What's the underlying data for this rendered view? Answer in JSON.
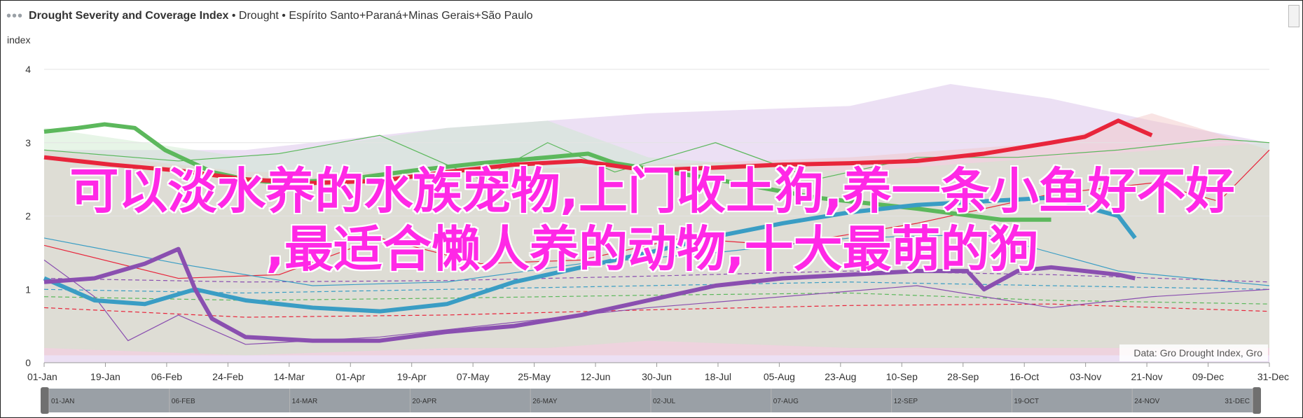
{
  "header": {
    "dots_icon": "ellipsis-icon",
    "title_bold": "Drought Severity and Coverage Index",
    "title_rest": " • Drought • Espírito Santo+Paraná+Minas Gerais+São Paulo"
  },
  "watermark": {
    "line1": "可以淡水养的水族宠物,上门收土狗,养一条小鱼好不好",
    "line2": ",最适合懒人养的动物,十大最萌的狗"
  },
  "chart_data": {
    "type": "line",
    "ylabel": "index",
    "ylim": [
      0,
      4
    ],
    "y_ticks": [
      "0",
      "1",
      "2",
      "3",
      "4"
    ],
    "x_ticks": [
      "01-Jan",
      "19-Jan",
      "06-Feb",
      "24-Feb",
      "14-Mar",
      "01-Apr",
      "19-Apr",
      "07-May",
      "25-May",
      "12-Jun",
      "30-Jun",
      "18-Jul",
      "05-Aug",
      "23-Aug",
      "10-Sep",
      "28-Sep",
      "16-Oct",
      "03-Nov",
      "21-Nov",
      "09-Dec",
      "31-Dec"
    ],
    "navigator_ticks": [
      "01-JAN",
      "06-FEB",
      "14-MAR",
      "20-APR",
      "26-MAY",
      "02-JUL",
      "07-AUG",
      "12-SEP",
      "19-OCT",
      "24-NOV",
      "31-DEC"
    ],
    "source": "Data: Gro Drought Index, Gro",
    "grid": true,
    "x_range_days": [
      0,
      365
    ],
    "series": [
      {
        "color": "#5cb85c",
        "style": "solid-thick",
        "x": [
          0,
          10,
          18,
          27,
          36,
          50,
          60,
          70,
          90,
          110,
          130,
          150,
          162,
          170,
          200,
          230,
          260,
          285,
          300
        ],
        "values": [
          3.15,
          3.2,
          3.25,
          3.2,
          2.9,
          2.6,
          2.5,
          2.45,
          2.5,
          2.62,
          2.72,
          2.8,
          2.85,
          2.72,
          2.5,
          2.25,
          2.1,
          1.95,
          1.95
        ]
      },
      {
        "color": "#e8253b",
        "style": "solid-thick",
        "x": [
          0,
          20,
          40,
          60,
          80,
          100,
          120,
          140,
          160,
          180,
          200,
          220,
          240,
          260,
          280,
          300,
          310,
          320,
          330
        ],
        "values": [
          2.8,
          2.7,
          2.62,
          2.5,
          2.45,
          2.48,
          2.6,
          2.7,
          2.75,
          2.62,
          2.66,
          2.7,
          2.72,
          2.75,
          2.85,
          3.0,
          3.08,
          3.3,
          3.1
        ]
      },
      {
        "color": "#3a9dc4",
        "style": "solid-thick",
        "x": [
          0,
          15,
          30,
          45,
          60,
          80,
          100,
          120,
          140,
          160,
          180,
          200,
          220,
          240,
          260,
          280,
          300,
          320,
          325
        ],
        "values": [
          1.15,
          0.85,
          0.8,
          1.0,
          0.85,
          0.75,
          0.7,
          0.8,
          1.1,
          1.3,
          1.5,
          1.72,
          1.9,
          2.05,
          2.15,
          2.2,
          2.25,
          2.0,
          1.7
        ]
      },
      {
        "color": "#8a4fb0",
        "style": "solid-thick",
        "x": [
          0,
          15,
          30,
          40,
          45,
          50,
          60,
          80,
          100,
          120,
          140,
          160,
          180,
          200,
          220,
          240,
          260,
          275,
          280,
          290,
          300,
          320,
          325
        ],
        "values": [
          1.1,
          1.15,
          1.35,
          1.55,
          1.0,
          0.6,
          0.35,
          0.3,
          0.3,
          0.42,
          0.5,
          0.65,
          0.85,
          1.05,
          1.15,
          1.2,
          1.25,
          1.25,
          1.0,
          1.25,
          1.3,
          1.2,
          1.15
        ]
      },
      {
        "color": "#5cb85c",
        "style": "thin",
        "x": [
          0,
          40,
          70,
          100,
          130,
          150,
          170,
          200,
          230,
          260,
          290,
          320,
          350,
          365
        ],
        "values": [
          2.9,
          2.75,
          2.85,
          3.1,
          2.5,
          3.0,
          2.6,
          3.0,
          2.5,
          2.8,
          2.8,
          2.9,
          3.05,
          3.0
        ]
      },
      {
        "color": "#e8253b",
        "style": "thin",
        "x": [
          0,
          40,
          70,
          100,
          130,
          160,
          190,
          220,
          260,
          300,
          330,
          350,
          365
        ],
        "values": [
          1.6,
          1.15,
          1.2,
          1.7,
          1.35,
          1.4,
          1.7,
          1.6,
          1.9,
          2.3,
          2.45,
          2.2,
          2.9
        ]
      },
      {
        "color": "#3a9dc4",
        "style": "thin",
        "x": [
          0,
          40,
          80,
          120,
          160,
          200,
          240,
          280,
          320,
          365
        ],
        "values": [
          1.7,
          1.35,
          1.05,
          1.1,
          1.35,
          1.5,
          1.7,
          1.75,
          1.25,
          1.05
        ]
      },
      {
        "color": "#8a4fb0",
        "style": "thin",
        "x": [
          0,
          15,
          25,
          40,
          60,
          100,
          140,
          180,
          220,
          260,
          300,
          330,
          365
        ],
        "values": [
          1.4,
          0.9,
          0.3,
          0.65,
          0.25,
          0.35,
          0.55,
          0.75,
          0.9,
          1.05,
          0.75,
          0.9,
          1.0
        ]
      },
      {
        "color": "#e8253b",
        "style": "dashed",
        "x": [
          0,
          60,
          120,
          180,
          240,
          300,
          365
        ],
        "values": [
          0.75,
          0.62,
          0.65,
          0.72,
          0.78,
          0.8,
          0.7
        ]
      },
      {
        "color": "#5cb85c",
        "style": "dashed",
        "x": [
          0,
          60,
          120,
          180,
          240,
          300,
          365
        ],
        "values": [
          0.9,
          0.85,
          0.88,
          0.92,
          0.95,
          0.85,
          0.8
        ]
      },
      {
        "color": "#3a9dc4",
        "style": "dashed",
        "x": [
          0,
          60,
          120,
          180,
          240,
          300,
          365
        ],
        "values": [
          1.0,
          0.95,
          1.0,
          1.05,
          1.1,
          1.05,
          1.0
        ]
      },
      {
        "color": "#8a4fb0",
        "style": "dashed",
        "x": [
          0,
          60,
          120,
          180,
          240,
          300,
          365
        ],
        "values": [
          1.15,
          1.1,
          1.12,
          1.18,
          1.25,
          1.2,
          1.1
        ]
      }
    ],
    "bands": [
      {
        "color": "#d4bbe6",
        "x": [
          0,
          60,
          120,
          180,
          240,
          270,
          300,
          330,
          365
        ],
        "upper": [
          2.9,
          2.9,
          3.2,
          3.4,
          3.5,
          3.8,
          3.6,
          3.3,
          3.0
        ],
        "lower": [
          0,
          0,
          0,
          0,
          0,
          0,
          0,
          0,
          0
        ]
      },
      {
        "color": "#f2c4c4",
        "x": [
          0,
          60,
          120,
          180,
          240,
          300,
          330,
          365
        ],
        "upper": [
          2.9,
          2.6,
          2.6,
          2.7,
          2.8,
          3.0,
          3.4,
          2.9
        ],
        "lower": [
          0.1,
          0.1,
          0.1,
          0.1,
          0.1,
          0.1,
          0.1,
          0.1
        ]
      },
      {
        "color": "#c9e8c9",
        "x": [
          0,
          60,
          120,
          150,
          180,
          240,
          300,
          365
        ],
        "upper": [
          3.2,
          2.8,
          3.2,
          3.3,
          2.8,
          2.6,
          2.8,
          3.0
        ],
        "lower": [
          0.2,
          0.1,
          0.2,
          0.2,
          0.3,
          0.2,
          0.2,
          0.2
        ]
      }
    ]
  }
}
